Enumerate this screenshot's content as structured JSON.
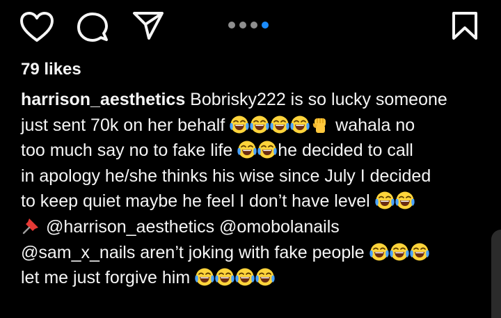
{
  "actions": {
    "like_icon": "heart-icon",
    "comment_icon": "comment-icon",
    "share_icon": "send-icon",
    "save_icon": "bookmark-icon"
  },
  "carousel": {
    "total": 4,
    "active_index": 4,
    "active_color": "#1a8cff",
    "inactive_color": "#8e8e8e"
  },
  "likes": "79 likes",
  "caption": {
    "username": "harrison_aesthetics",
    "l1": " Bobrisky222 is so lucky someone",
    "l2a": "just sent 70k on her behalf ",
    "l2b": " wahala no",
    "l3a": "too much say no to fake life ",
    "l3b": "he decided to call",
    "l4": "in apology he/she thinks his wise since July I decided",
    "l5a": "to keep quiet maybe he feel I don’t have level ",
    "l6": " @harrison_aesthetics @omobolanails",
    "l7a": "@sam_x_nails aren’t joking with fake people ",
    "l8a": "let me just forgive him "
  },
  "emoji": {
    "laugh": "face-with-tears-of-joy",
    "fist": "raised-fist",
    "pin": "pushpin"
  }
}
